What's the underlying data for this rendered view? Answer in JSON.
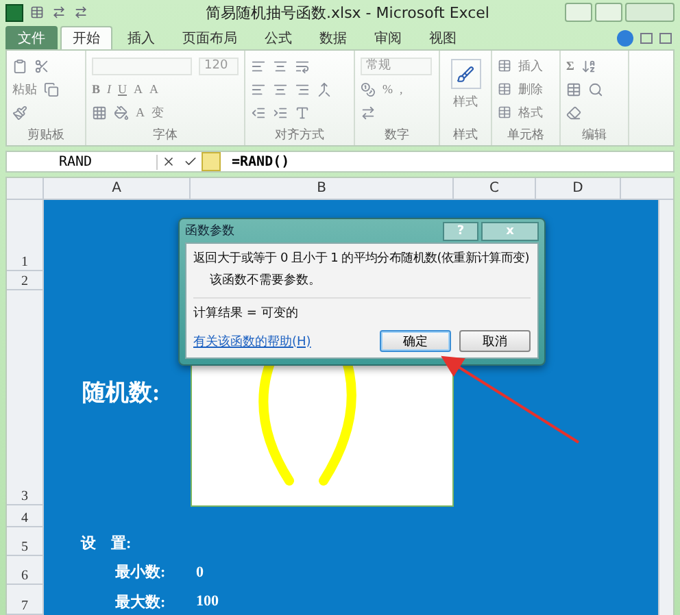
{
  "window": {
    "title": "简易随机抽号函数.xlsx - Microsoft Excel"
  },
  "ribbon_tabs": [
    {
      "label": "文件",
      "kind": "file",
      "selected": false
    },
    {
      "label": "开始",
      "kind": "tab",
      "selected": true
    },
    {
      "label": "插入",
      "kind": "tab",
      "selected": false
    },
    {
      "label": "页面布局",
      "kind": "tab",
      "selected": false
    },
    {
      "label": "公式",
      "kind": "tab",
      "selected": false
    },
    {
      "label": "数据",
      "kind": "tab",
      "selected": false
    },
    {
      "label": "审阅",
      "kind": "tab",
      "selected": false
    },
    {
      "label": "视图",
      "kind": "tab",
      "selected": false
    }
  ],
  "ribbon": {
    "clipboard": {
      "label": "剪贴板",
      "paste": "粘贴"
    },
    "font": {
      "label": "字体",
      "size": "120",
      "bold": "B",
      "italic": "I",
      "underline": "U",
      "grow": "A",
      "shrink": "A",
      "font_color": "A",
      "phonetic": "变"
    },
    "alignment": {
      "label": "对齐方式"
    },
    "number": {
      "label": "数字",
      "format": "常规",
      "percent": "%",
      "comma": ","
    },
    "styles": {
      "label": "样式",
      "button": "样式"
    },
    "cells": {
      "label": "单元格",
      "items": [
        "插入",
        "删除",
        "格式"
      ]
    },
    "editing": {
      "label": "编辑",
      "sum": "Σ"
    }
  },
  "formula_bar": {
    "name_box": "RAND",
    "formula": "=RAND()"
  },
  "columns": [
    "A",
    "B",
    "C",
    "D"
  ],
  "rows": [
    "1",
    "2",
    "3",
    "4",
    "5",
    "6",
    "7"
  ],
  "sheet": {
    "random_label": "随机数:",
    "settings_label": "设　置:",
    "min_label": "最小数:",
    "min_value": "0",
    "max_label": "最大数:",
    "max_value": "100"
  },
  "dialog": {
    "title": "函数参数",
    "help": "?",
    "close": "x",
    "description": "返回大于或等于 0 且小于 1 的平均分布随机数(依重新计算而变)",
    "note": "该函数不需要参数。",
    "result": "计算结果 = 可变的",
    "help_link": "有关该函数的帮助(H)",
    "buttons": [
      {
        "label": "确定",
        "focused": true
      },
      {
        "label": "取消",
        "focused": false
      }
    ]
  }
}
